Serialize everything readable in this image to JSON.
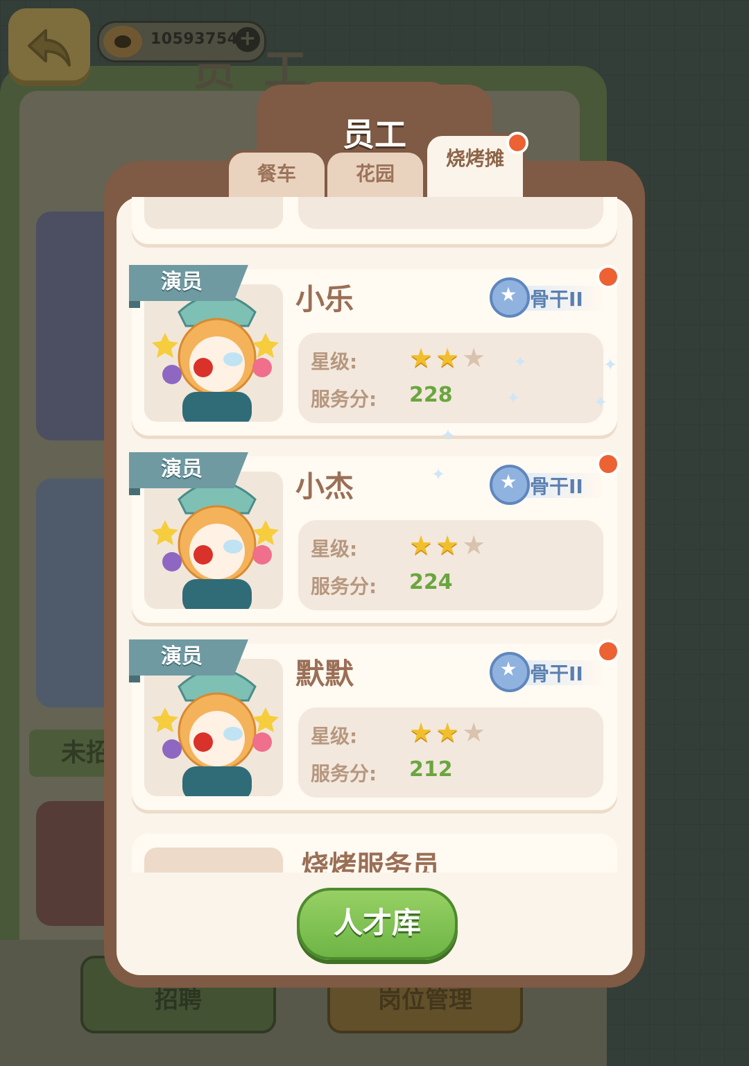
{
  "top_bar": {
    "coins": "10593754",
    "plus_label": "+"
  },
  "background": {
    "title": "员工",
    "green_btn": "未招",
    "btn_left": "招聘",
    "btn_right": "岗位管理"
  },
  "modal": {
    "title": "员工",
    "tabs": [
      {
        "label": "餐车",
        "active": false
      },
      {
        "label": "花园",
        "active": false
      },
      {
        "label": "烧烤摊",
        "active": true,
        "has_dot": true
      }
    ],
    "labels": {
      "star_level": "星级:",
      "service_score": "服务分:"
    },
    "employees": [
      {
        "role": "演员",
        "name": "小乐",
        "rank": "骨干II",
        "stars": 2,
        "max_stars": 3,
        "score": "228",
        "notice": true
      },
      {
        "role": "演员",
        "name": "小杰",
        "rank": "骨干II",
        "stars": 2,
        "max_stars": 3,
        "score": "224",
        "notice": true
      },
      {
        "role": "演员",
        "name": "默默",
        "rank": "骨干II",
        "stars": 2,
        "max_stars": 3,
        "score": "212",
        "notice": true
      }
    ],
    "placeholder_card": {
      "title": "烧烤服务员"
    },
    "talent_button": "人才库"
  },
  "colors": {
    "modal_frame": "#7f5a44",
    "modal_inner": "#fbf4ea",
    "role_ribbon": "#6f9aa2",
    "score_green": "#6aa63f",
    "notice_dot": "#ec6233",
    "talent_button": "#7dbd50"
  },
  "icons": {
    "back": "back-arrow-icon",
    "coin": "paw-coin-icon",
    "rank": "star-medal-icon",
    "star": "star-icon"
  }
}
